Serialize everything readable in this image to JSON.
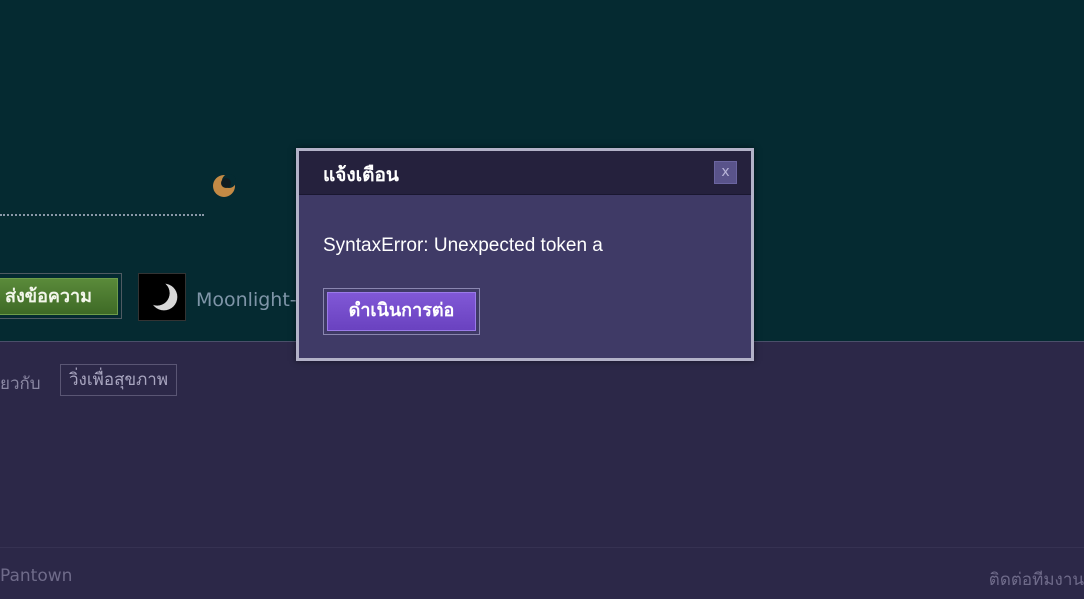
{
  "page": {
    "send_button_label": "ส่งข้อความ",
    "username": "Moonlight-E",
    "related_label": "ยวกับ",
    "tag_label": "วิ่งเพื่อสุขภาพ",
    "footer_left": "Pantown",
    "footer_right": "ติดต่อทีมงาน"
  },
  "dialog": {
    "title": "แจ้งเตือน",
    "close_label": "x",
    "message": "SyntaxError: Unexpected token a",
    "continue_label": "ดำเนินการต่อ"
  },
  "colors": {
    "top_background": "#052a31",
    "bottom_background": "#2c2848",
    "dialog_body": "#3f3a66",
    "dialog_header": "#25213d",
    "continue_button": "#6a42c0",
    "send_button": "#4a7a2e"
  },
  "icons": {
    "moon": "crescent-moon-icon",
    "avatar": "moon-avatar",
    "close": "close-icon"
  }
}
